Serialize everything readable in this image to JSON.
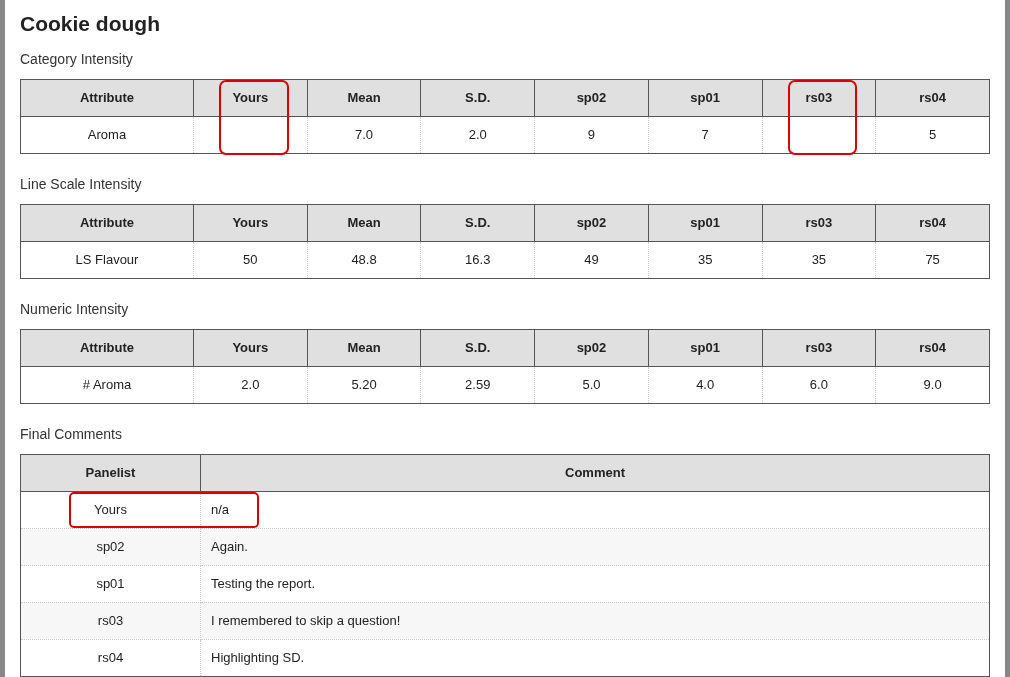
{
  "title": "Cookie dough",
  "sections": [
    {
      "kind": "intensity",
      "heading": "Category Intensity",
      "columns": [
        {
          "label": "Attribute",
          "highlighted": false
        },
        {
          "label": "Yours",
          "highlighted": true
        },
        {
          "label": "Mean",
          "highlighted": false
        },
        {
          "label": "S.D.",
          "highlighted": false
        },
        {
          "label": "sp02",
          "highlighted": false
        },
        {
          "label": "sp01",
          "highlighted": false
        },
        {
          "label": "rs03",
          "highlighted": true
        },
        {
          "label": "rs04",
          "highlighted": false
        }
      ],
      "rows": [
        {
          "cells": [
            "Aroma",
            "",
            "7.0",
            "2.0",
            "9",
            "7",
            "",
            "5"
          ]
        }
      ]
    },
    {
      "kind": "intensity",
      "heading": "Line Scale Intensity",
      "columns": [
        {
          "label": "Attribute",
          "highlighted": false
        },
        {
          "label": "Yours",
          "highlighted": false
        },
        {
          "label": "Mean",
          "highlighted": false
        },
        {
          "label": "S.D.",
          "highlighted": false
        },
        {
          "label": "sp02",
          "highlighted": false
        },
        {
          "label": "sp01",
          "highlighted": false
        },
        {
          "label": "rs03",
          "highlighted": false
        },
        {
          "label": "rs04",
          "highlighted": false
        }
      ],
      "rows": [
        {
          "cells": [
            "LS Flavour",
            "50",
            "48.8",
            "16.3",
            "49",
            "35",
            "35",
            "75"
          ]
        }
      ]
    },
    {
      "kind": "intensity",
      "heading": "Numeric Intensity",
      "columns": [
        {
          "label": "Attribute",
          "highlighted": false
        },
        {
          "label": "Yours",
          "highlighted": false
        },
        {
          "label": "Mean",
          "highlighted": false
        },
        {
          "label": "S.D.",
          "highlighted": false
        },
        {
          "label": "sp02",
          "highlighted": false
        },
        {
          "label": "sp01",
          "highlighted": false
        },
        {
          "label": "rs03",
          "highlighted": false
        },
        {
          "label": "rs04",
          "highlighted": false
        }
      ],
      "rows": [
        {
          "cells": [
            "# Aroma",
            "2.0",
            "5.20",
            "2.59",
            "5.0",
            "4.0",
            "6.0",
            "9.0"
          ]
        }
      ]
    },
    {
      "kind": "comments",
      "heading": "Final Comments",
      "columns": [
        {
          "label": "Panelist",
          "highlighted": false
        },
        {
          "label": "Comment",
          "highlighted": false
        }
      ],
      "rows": [
        {
          "cells": [
            "Yours",
            "n/a"
          ],
          "highlighted": true
        },
        {
          "cells": [
            "sp02",
            "Again."
          ],
          "highlighted": false
        },
        {
          "cells": [
            "sp01",
            "Testing the report."
          ],
          "highlighted": false
        },
        {
          "cells": [
            "rs03",
            "I remembered to skip a question!"
          ],
          "highlighted": false
        },
        {
          "cells": [
            "rs04",
            "Highlighting SD."
          ],
          "highlighted": false
        }
      ]
    }
  ]
}
